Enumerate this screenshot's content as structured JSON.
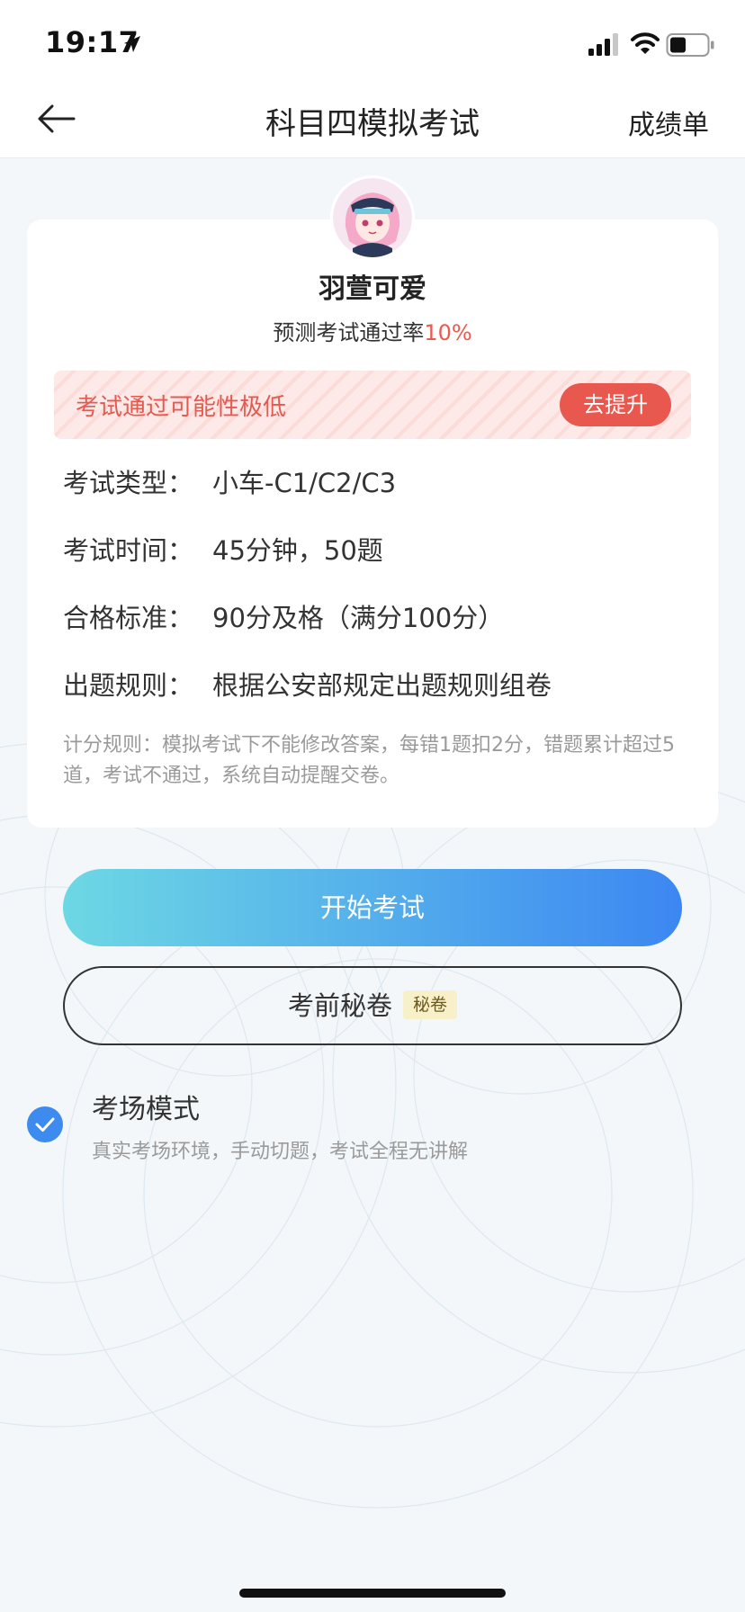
{
  "status_bar": {
    "time": "19:17"
  },
  "nav": {
    "title": "科目四模拟考试",
    "right_label": "成绩单"
  },
  "profile": {
    "name": "羽萱可爱",
    "pass_rate_label": "预测考试通过率",
    "pass_rate_value": "10%"
  },
  "warning": {
    "text": "考试通过可能性极低",
    "button_label": "去提升"
  },
  "info": {
    "type_label": "考试类型：",
    "type_value": "小车-C1/C2/C3",
    "time_label": "考试时间：",
    "time_value": "45分钟，50题",
    "standard_label": "合格标准：",
    "standard_value": "90分及格（满分100分）",
    "rule_label": "出题规则：",
    "rule_value": "根据公安部规定出题规则组卷"
  },
  "scoring_note": "计分规则：模拟考试下不能修改答案，每错1题扣2分，错题累计超过5道，考试不通过，系统自动提醒交卷。",
  "actions": {
    "start_label": "开始考试",
    "secret_label": "考前秘卷",
    "secret_tag": "秘卷"
  },
  "exam_mode": {
    "title": "考场模式",
    "description": "真实考场环境，手动切题，考试全程无讲解",
    "checked": true
  },
  "colors": {
    "accent_red": "#e9584e",
    "gradient_start": "#6dd8e4",
    "gradient_end": "#3c87f2",
    "check_blue": "#3e8bf0"
  },
  "icons": [
    "location-arrow-icon",
    "signal-icon",
    "wifi-icon",
    "battery-icon",
    "back-arrow-icon",
    "checkmark-icon"
  ]
}
